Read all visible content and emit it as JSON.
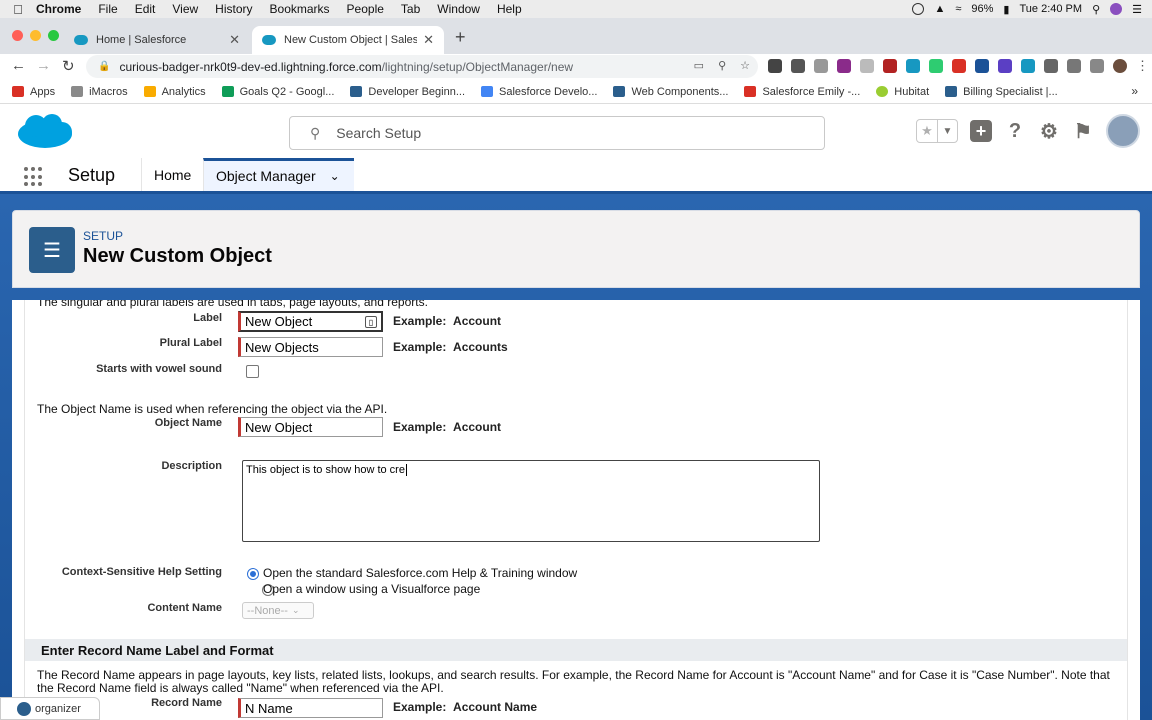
{
  "menubar": {
    "app": "Chrome",
    "items": [
      "File",
      "Edit",
      "View",
      "History",
      "Bookmarks",
      "People",
      "Tab",
      "Window",
      "Help"
    ],
    "battery": "96%",
    "clock": "Tue 2:40 PM"
  },
  "tabs": [
    {
      "title": "Home | Salesforce"
    },
    {
      "title": "New Custom Object | Salesforce"
    }
  ],
  "omnibox": {
    "host": "curious-badger-nrk0t9-dev-ed.lightning.force.com",
    "path": "/lightning/setup/ObjectManager/new"
  },
  "bookmarks": [
    {
      "label": "Apps",
      "color": "#d93025"
    },
    {
      "label": "iMacros",
      "color": "#8a8a8a"
    },
    {
      "label": "Analytics",
      "color": "#f9ab00"
    },
    {
      "label": "Goals Q2 - Googl...",
      "color": "#0f9d58"
    },
    {
      "label": "Developer Beginn...",
      "color": "#2b5e8c"
    },
    {
      "label": "Salesforce Develo...",
      "color": "#4285f4"
    },
    {
      "label": "Web Components...",
      "color": "#2b5e8c"
    },
    {
      "label": "Salesforce Emily -...",
      "color": "#d93025"
    },
    {
      "label": "Hubitat",
      "color": "#9acd32"
    },
    {
      "label": "Billing Specialist |...",
      "color": "#2b5e8c"
    }
  ],
  "sf": {
    "search_placeholder": "Search Setup",
    "app_name": "Setup",
    "nav_home": "Home",
    "nav_object_manager": "Object Manager",
    "eyebrow": "SETUP",
    "page_title": "New Custom Object"
  },
  "form": {
    "labels_intro": "The singular and plural labels are used in tabs, page layouts, and reports.",
    "label_label": "Label",
    "label_value": "New Object",
    "plural_label": "Plural Label",
    "plural_value": "New Objects",
    "vowel_label": "Starts with vowel sound",
    "example_prefix": "Example:",
    "example_account": "Account",
    "example_accounts": "Accounts",
    "api_intro": "The Object Name is used when referencing the object via the API.",
    "object_name_label": "Object Name",
    "object_name_value": "New Object",
    "description_label": "Description",
    "description_value": "This object is to show how to cre",
    "help_label": "Context-Sensitive Help Setting",
    "help_opt1": "Open the standard Salesforce.com Help & Training window",
    "help_opt2": "Open a window using a Visualforce page",
    "content_name_label": "Content Name",
    "content_name_value": "--None--",
    "record_section_title": "Enter Record Name Label and Format",
    "record_intro": "The Record Name appears in page layouts, key lists, related lists, lookups, and search results. For example, the Record Name for Account is \"Account Name\" and for Case it is \"Case Number\". Note that the Record Name field is always called \"Name\" when referenced via the API.",
    "record_name_label": "Record Name",
    "record_name_value": "N Name",
    "record_example": "Account Name"
  },
  "organizer": {
    "label": "organizer"
  },
  "colors": {
    "brand_blue": "#1b5297",
    "required_red": "#c23934"
  }
}
